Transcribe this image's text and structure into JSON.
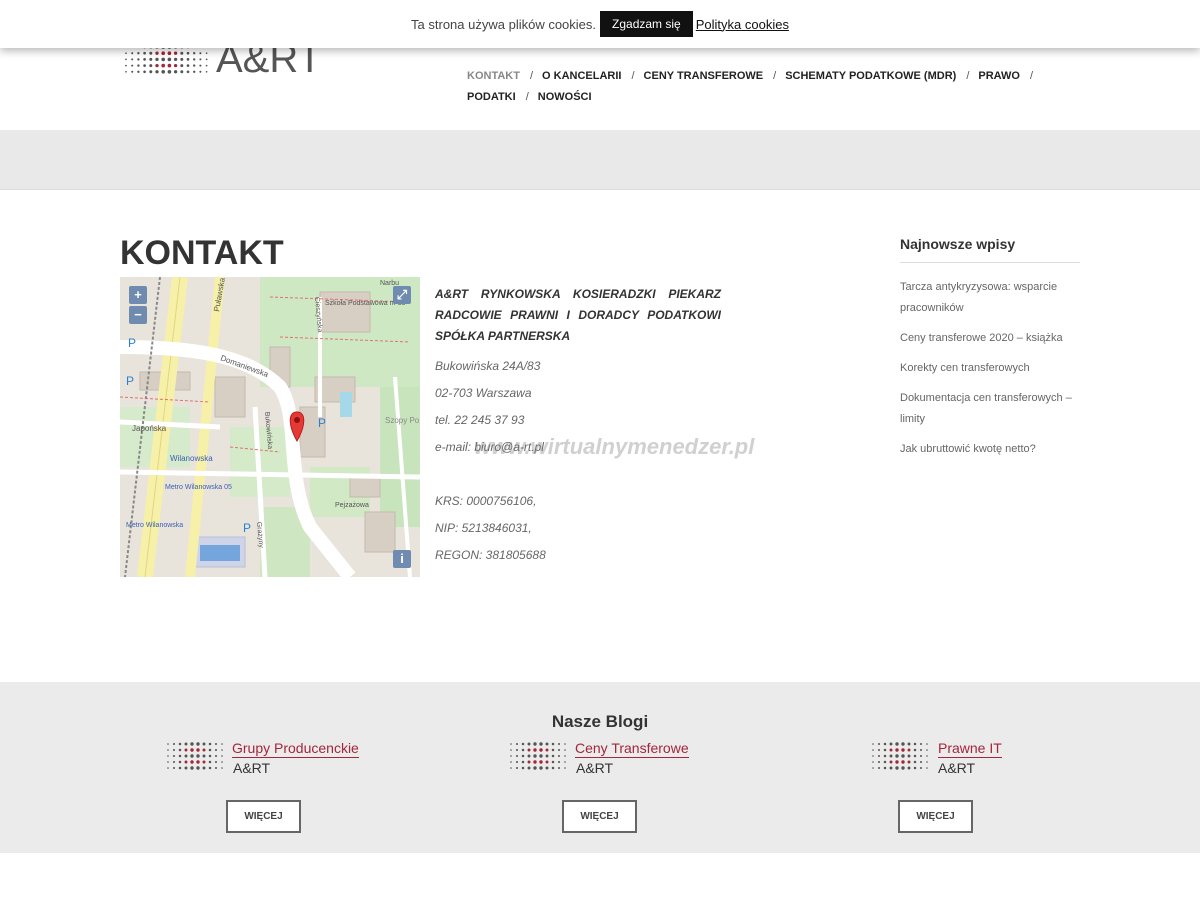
{
  "cookie": {
    "message": "Ta strona używa plików cookies.",
    "accept_label": "Zgadzam się",
    "policy_label": "Polityka cookies"
  },
  "logo": {
    "text": "A&RT"
  },
  "nav": {
    "items": [
      "KONTAKT",
      "O KANCELARII",
      "CENY TRANSFEROWE",
      "SCHEMATY PODATKOWE (MDR)",
      "PRAWO",
      "PODATKI",
      "NOWOŚCI"
    ],
    "separator": "/"
  },
  "page": {
    "title": "KONTAKT"
  },
  "map": {
    "zoom_in": "+",
    "zoom_out": "−",
    "fullscreen": "⤢",
    "info": "i",
    "labels": [
      "Puławska",
      "Domaniewska",
      "Japońska",
      "Wilanowska",
      "Metro Wilanowska 05",
      "Metro Wilanowska",
      "Bukowińska",
      "Cieszyńska",
      "Pejzażowa",
      "Grażyny",
      "Szkoła Podstawowa nr 33",
      "Szopy Po",
      "Narbu"
    ]
  },
  "contact": {
    "company": "A&RT RYNKOWSKA KOSIERADZKI PIEKARZ RADCOWIE PRAWNI I DORADCY PODATKOWI SPÓŁKA PARTNERSKA",
    "street": "Bukowińska 24A/83",
    "city": "02-703 Warszawa",
    "phone": "tel. 22 245 37 93",
    "email": "e-mail: biuro@a-rt.pl",
    "krs": "KRS: 0000756106,",
    "nip": "NIP: 5213846031,",
    "regon": "REGON: 381805688",
    "watermark": "www.wirtualnymenedzer.pl"
  },
  "sidebar": {
    "title": "Najnowsze wpisy",
    "posts": [
      "Tarcza antykryzysowa: wsparcie pracowników",
      "Ceny transferowe 2020 – książka",
      "Korekty cen transferowych",
      "Dokumentacja cen transferowych – limity",
      "Jak ubruttowić kwotę netto?"
    ]
  },
  "footer": {
    "title": "Nasze Blogi",
    "blogs": [
      {
        "name": "Grupy Producenckie",
        "brand": "A&RT",
        "button": "WIĘCEJ"
      },
      {
        "name": "Ceny Transferowe",
        "brand": "A&RT",
        "button": "WIĘCEJ"
      },
      {
        "name": "Prawne IT",
        "brand": "A&RT",
        "button": "WIĘCEJ"
      }
    ]
  },
  "colors": {
    "accent_red": "#a3263a",
    "map_marker": "#e53935",
    "band_grey": "#e9e9e9"
  }
}
